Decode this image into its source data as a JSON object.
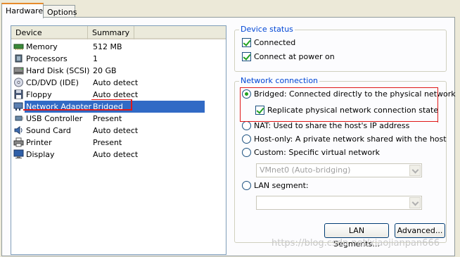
{
  "tabs": [
    {
      "label": "Hardware",
      "active": true
    },
    {
      "label": "Options",
      "active": false
    }
  ],
  "device_list": {
    "columns": [
      "Device",
      "Summary"
    ],
    "rows": [
      {
        "icon": "memory-icon",
        "device": "Memory",
        "summary": "512 MB"
      },
      {
        "icon": "processor-icon",
        "device": "Processors",
        "summary": "1"
      },
      {
        "icon": "hard-disk-icon",
        "device": "Hard Disk (SCSI)",
        "summary": "20 GB"
      },
      {
        "icon": "cd-dvd-icon",
        "device": "CD/DVD (IDE)",
        "summary": "Auto detect"
      },
      {
        "icon": "floppy-icon",
        "device": "Floppy",
        "summary": "Auto detect"
      },
      {
        "icon": "network-adapter-icon",
        "device": "Network Adapter",
        "summary": "Bridged",
        "selected": true
      },
      {
        "icon": "usb-icon",
        "device": "USB Controller",
        "summary": "Present"
      },
      {
        "icon": "sound-card-icon",
        "device": "Sound Card",
        "summary": "Auto detect"
      },
      {
        "icon": "printer-icon",
        "device": "Printer",
        "summary": "Present"
      },
      {
        "icon": "display-icon",
        "device": "Display",
        "summary": "Auto detect"
      }
    ]
  },
  "device_status": {
    "title": "Device status",
    "connected": {
      "label": "Connected",
      "checked": true
    },
    "connect_at_power_on": {
      "label": "Connect at power on",
      "checked": true
    }
  },
  "network_connection": {
    "title": "Network connection",
    "bridged": {
      "label": "Bridged: Connected directly to the physical network",
      "selected": true
    },
    "replicate": {
      "label": "Replicate physical network connection state",
      "checked": true
    },
    "nat": {
      "label": "NAT: Used to share the host's IP address",
      "selected": false
    },
    "host_only": {
      "label": "Host-only: A private network shared with the host",
      "selected": false
    },
    "custom": {
      "label": "Custom: Specific virtual network",
      "selected": false
    },
    "vmnet_select": {
      "value": "VMnet0 (Auto-bridging)"
    },
    "lan_segment": {
      "label": "LAN segment:",
      "selected": false
    },
    "lan_segment_select": {
      "value": ""
    }
  },
  "buttons": {
    "lan_segments": "LAN Segments...",
    "advanced": "Advanced..."
  },
  "watermark": "https://blog.csdn.net/xiaojianpan666",
  "colors": {
    "selection": "#316ac5",
    "group_title": "#0046d5",
    "annotation_red": "#e01818",
    "check_green": "#21a121"
  }
}
